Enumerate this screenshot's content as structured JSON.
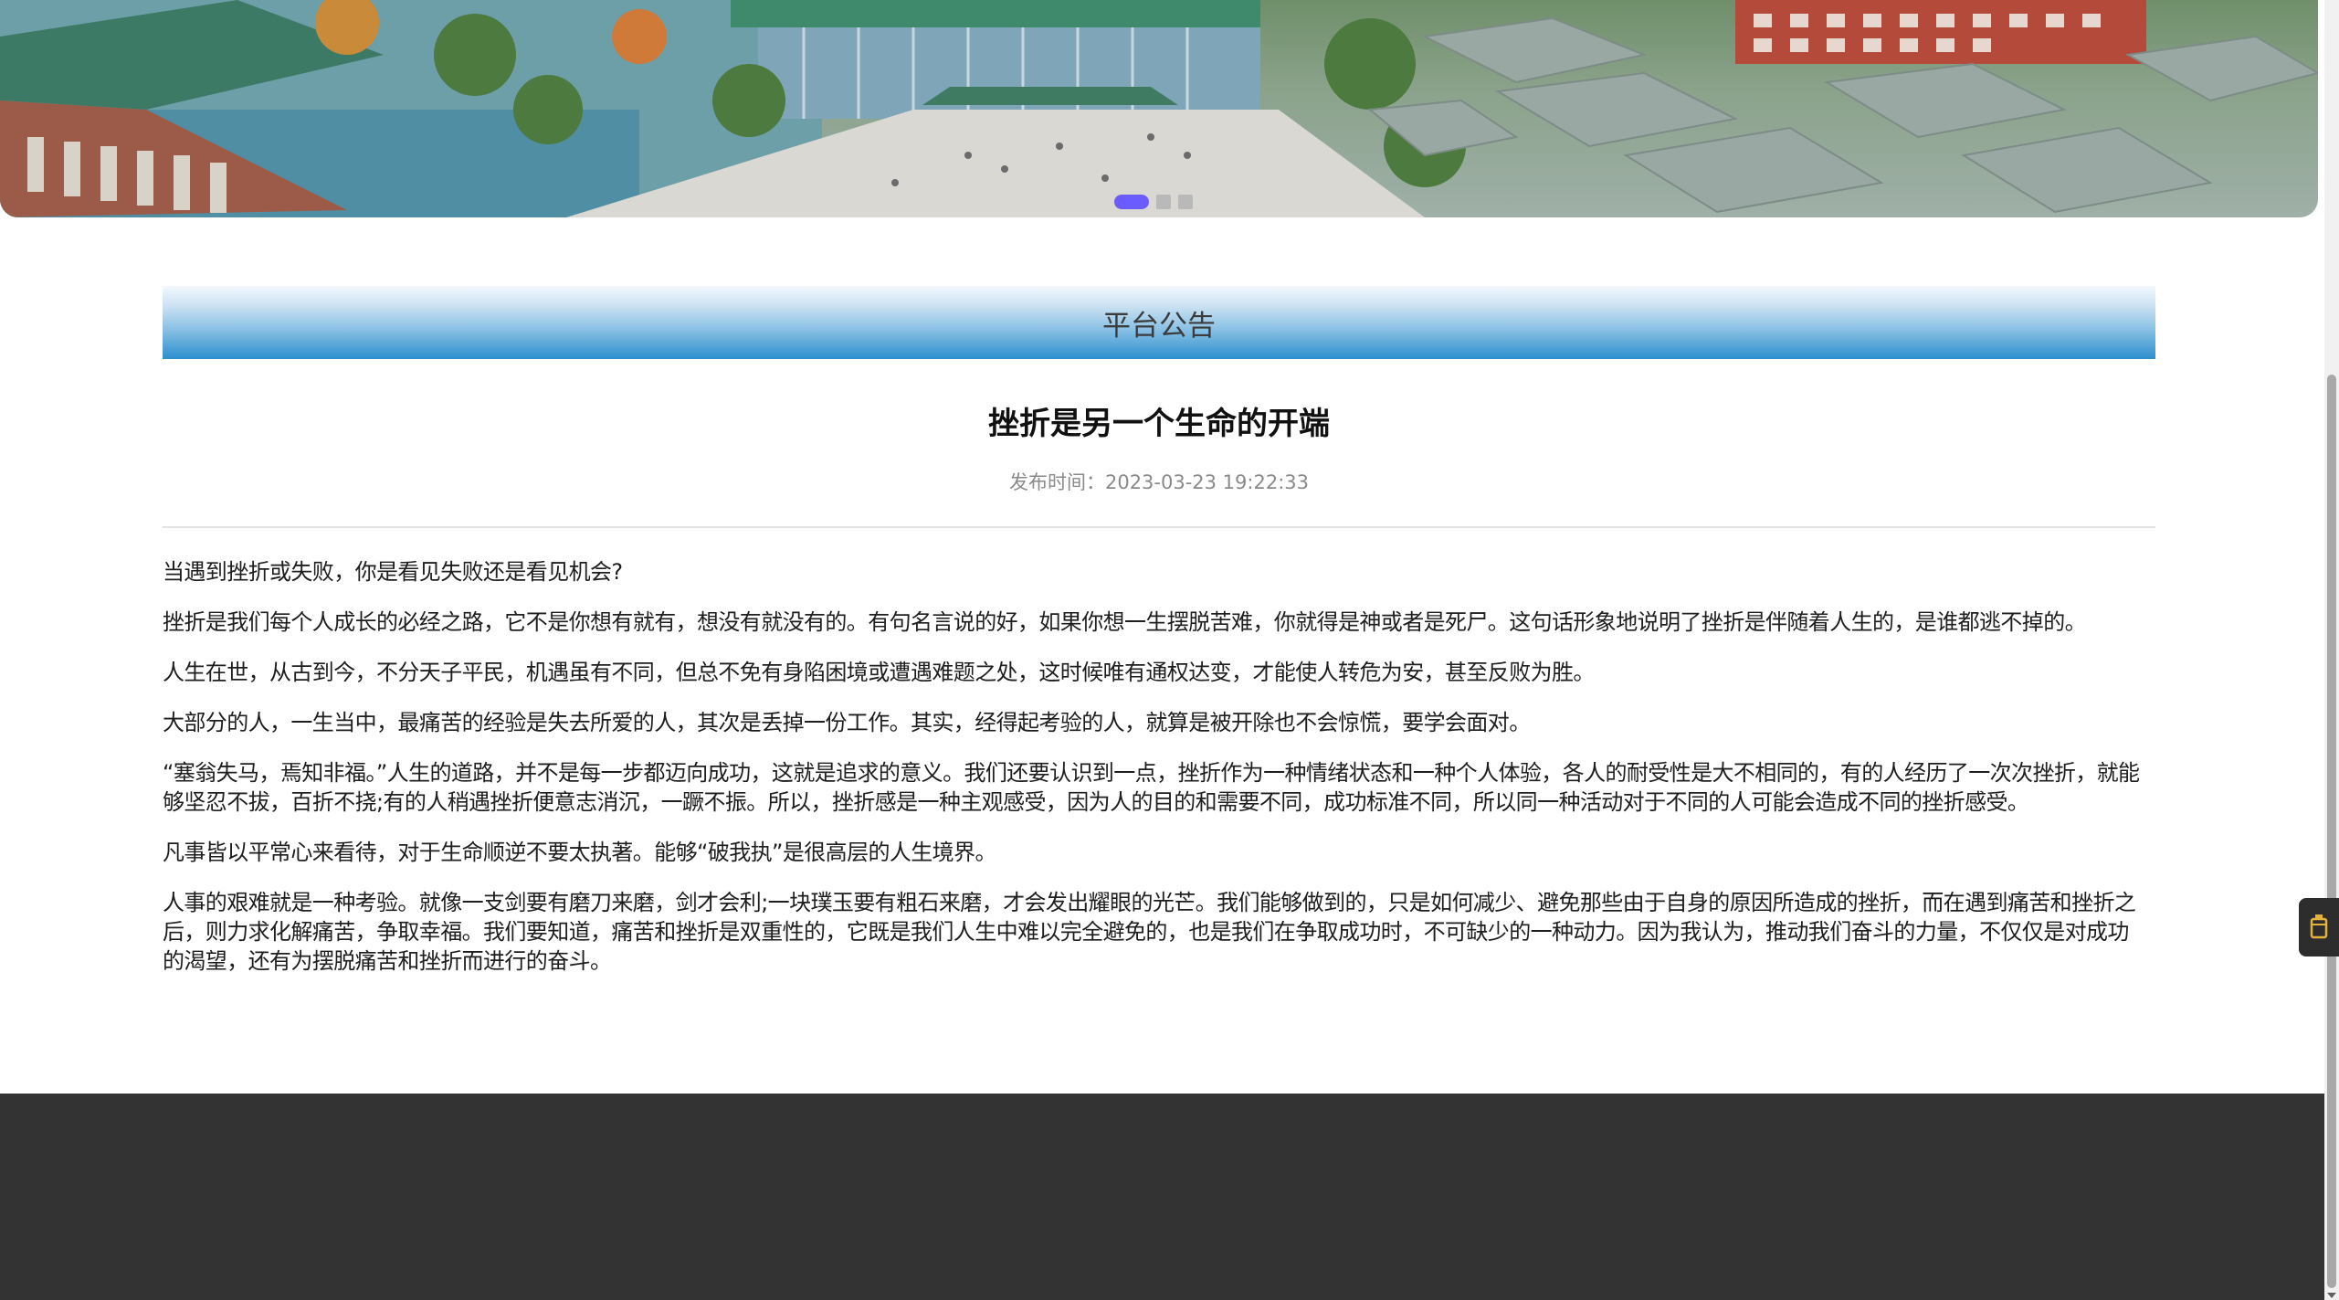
{
  "banner": {
    "slide_count": 3,
    "active_slide": 1,
    "indicator_color": "#6a5cff"
  },
  "notice": {
    "section_title": "平台公告",
    "bar_color": "#2c8fcd"
  },
  "article": {
    "title": "挫折是另一个生命的开端",
    "publish_label": "发布时间：",
    "publish_time": "2023-03-23 19:22:33",
    "paragraphs": [
      "当遇到挫折或失败，你是看见失败还是看见机会?",
      "挫折是我们每个人成长的必经之路，它不是你想有就有，想没有就没有的。有句名言说的好，如果你想一生摆脱苦难，你就得是神或者是死尸。这句话形象地说明了挫折是伴随着人生的，是谁都逃不掉的。",
      "人生在世，从古到今，不分天子平民，机遇虽有不同，但总不免有身陷困境或遭遇难题之处，这时候唯有通权达变，才能使人转危为安，甚至反败为胜。",
      "大部分的人，一生当中，最痛苦的经验是失去所爱的人，其次是丢掉一份工作。其实，经得起考验的人，就算是被开除也不会惊慌，要学会面对。",
      "“塞翁失马，焉知非福。”人生的道路，并不是每一步都迈向成功，这就是追求的意义。我们还要认识到一点，挫折作为一种情绪状态和一种个人体验，各人的耐受性是大不相同的，有的人经历了一次次挫折，就能够坚忍不拔，百折不挠;有的人稍遇挫折便意志消沉，一蹶不振。所以，挫折感是一种主观感受，因为人的目的和需要不同，成功标准不同，所以同一种活动对于不同的人可能会造成不同的挫折感受。",
      "凡事皆以平常心来看待，对于生命顺逆不要太执著。能够“破我执”是很高层的人生境界。",
      "人事的艰难就是一种考验。就像一支剑要有磨刀来磨，剑才会利;一块璞玉要有粗石来磨，才会发出耀眼的光芒。我们能够做到的，只是如何减少、避免那些由于自身的原因所造成的挫折，而在遇到痛苦和挫折之后，则力求化解痛苦，争取幸福。我们要知道，痛苦和挫折是双重性的，它既是我们人生中难以完全避免的，也是我们在争取成功时，不可缺少的一种动力。因为我认为，推动我们奋斗的力量，不仅仅是对成功的渴望，还有为摆脱痛苦和挫折而进行的奋斗。"
    ]
  },
  "footer": {
    "background": "#333333"
  },
  "side_tab": {
    "icon": "cup-icon"
  }
}
